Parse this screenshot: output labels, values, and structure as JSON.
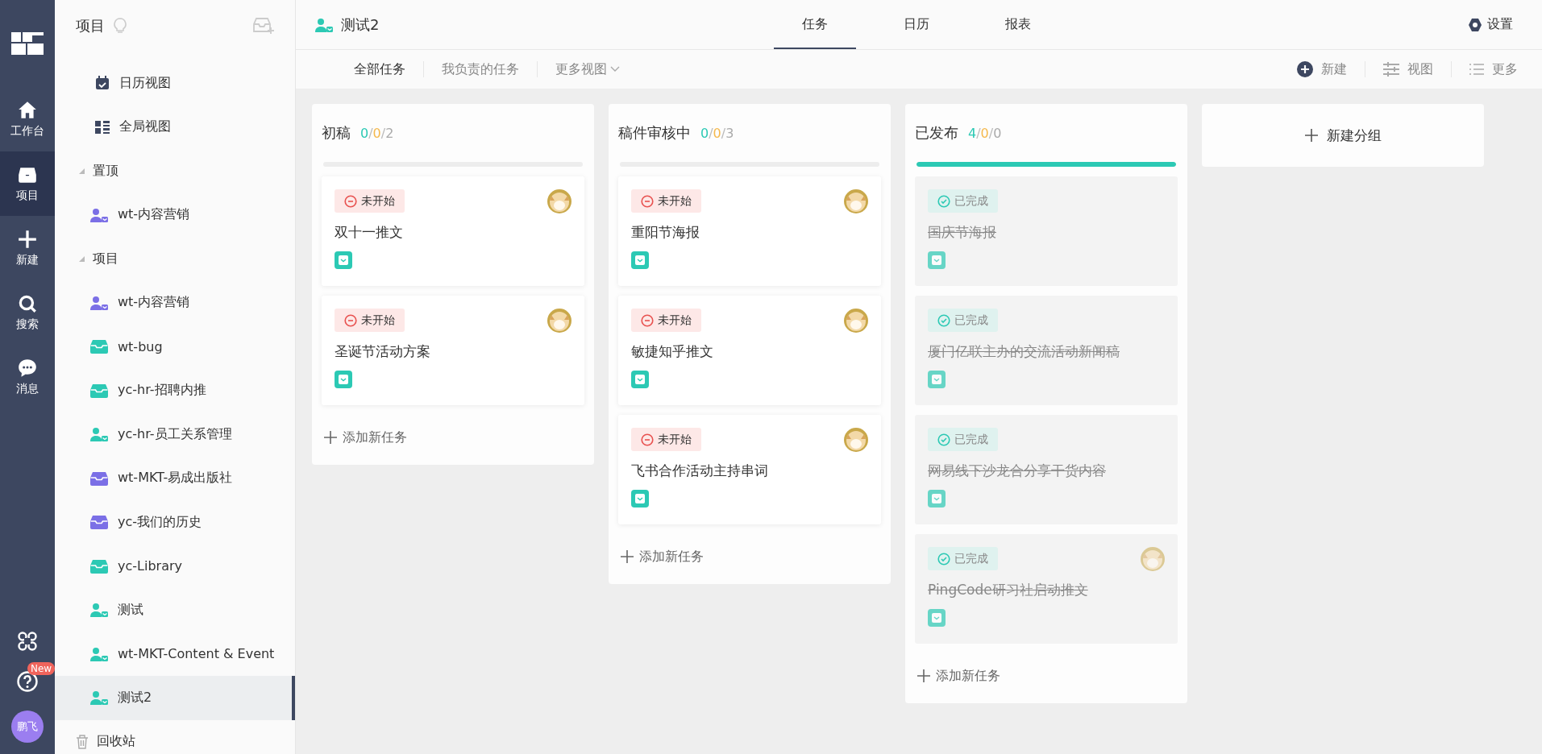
{
  "rail": {
    "items": [
      {
        "label": "工作台",
        "kind": "home",
        "selected": false
      },
      {
        "label": "项目",
        "kind": "box",
        "selected": true
      },
      {
        "label": "新建",
        "kind": "plus",
        "selected": false
      },
      {
        "label": "搜索",
        "kind": "search",
        "selected": false
      },
      {
        "label": "消息",
        "kind": "chat",
        "selected": false
      }
    ],
    "badge": "New",
    "user": "鹏飞"
  },
  "sidebar": {
    "title": "项目",
    "views": [
      {
        "label": "日历视图",
        "kind": "calendar"
      },
      {
        "label": "全局视图",
        "kind": "grid"
      }
    ],
    "sections": [
      {
        "label": "置顶",
        "expanded": true,
        "items": [
          {
            "label": "wt-内容营销",
            "kind": "person",
            "color": "#7b6fe6",
            "selected": false
          }
        ]
      },
      {
        "label": "项目",
        "expanded": true,
        "items": [
          {
            "label": "wt-内容营销",
            "kind": "person",
            "color": "#7b6fe6",
            "selected": false
          },
          {
            "label": "wt-bug",
            "kind": "box",
            "color": "#2cc9b4",
            "selected": false
          },
          {
            "label": "yc-hr-招聘内推",
            "kind": "box",
            "color": "#2cc9b4",
            "selected": false
          },
          {
            "label": "yc-hr-员工关系管理",
            "kind": "person",
            "color": "#2cc9b4",
            "selected": false
          },
          {
            "label": "wt-MKT-易成出版社",
            "kind": "box",
            "color": "#7b6fe6",
            "selected": false
          },
          {
            "label": "yc-我们的历史",
            "kind": "box",
            "color": "#7b6fe6",
            "selected": false
          },
          {
            "label": "yc-Library",
            "kind": "box",
            "color": "#2cc9b4",
            "selected": false
          },
          {
            "label": "测试",
            "kind": "person",
            "color": "#2cc9b4",
            "selected": false
          },
          {
            "label": "wt-MKT-Content & Event",
            "kind": "person",
            "color": "#2cc9b4",
            "selected": false
          },
          {
            "label": "测试2",
            "kind": "person",
            "color": "#2cc9b4",
            "selected": true
          }
        ]
      }
    ],
    "trash": "回收站"
  },
  "header": {
    "project": "测试2",
    "tabs": [
      {
        "label": "任务",
        "selected": true
      },
      {
        "label": "日历",
        "selected": false
      },
      {
        "label": "报表",
        "selected": false
      }
    ],
    "settings": "设置"
  },
  "subnav": {
    "filters": [
      {
        "label": "全部任务",
        "selected": true
      },
      {
        "label": "我负责的任务",
        "selected": false
      },
      {
        "label": "更多视图",
        "selected": false,
        "dropdown": true
      }
    ],
    "actions": [
      {
        "label": "新建",
        "kind": "plus"
      },
      {
        "label": "视图",
        "kind": "sliders"
      },
      {
        "label": "更多",
        "kind": "list"
      }
    ]
  },
  "board": {
    "columns": [
      {
        "title": "初稿",
        "count": [
          "0",
          "/",
          "0",
          "/",
          "2"
        ],
        "level": 0,
        "add": "添加新任务",
        "cards": [
          {
            "kind": "not_started",
            "status_label": "未开始",
            "title": "双十一推文",
            "avatar": true
          },
          {
            "kind": "not_started",
            "status_label": "未开始",
            "title": "圣诞节活动方案",
            "avatar": true
          }
        ]
      },
      {
        "title": "稿件审核中",
        "count": [
          "0",
          "/",
          "0",
          "/",
          "3"
        ],
        "level": 0,
        "add": "添加新任务",
        "cards": [
          {
            "kind": "not_started",
            "status_label": "未开始",
            "title": "重阳节海报",
            "avatar": true
          },
          {
            "kind": "not_started",
            "status_label": "未开始",
            "title": "敏捷知乎推文",
            "avatar": true
          },
          {
            "kind": "not_started",
            "status_label": "未开始",
            "title": "飞书合作活动主持串词",
            "avatar": true
          }
        ]
      },
      {
        "title": "已发布",
        "count": [
          "4",
          "/",
          "0",
          "/",
          "0"
        ],
        "level": 1,
        "add": "添加新任务",
        "cards": [
          {
            "kind": "done",
            "status_label": "已完成",
            "title": "国庆节海报",
            "avatar": false
          },
          {
            "kind": "done",
            "status_label": "已完成",
            "title": "厦门亿联主办的交流活动新闻稿",
            "avatar": false
          },
          {
            "kind": "done",
            "status_label": "已完成",
            "title": "网易线下沙龙合分享干货内容",
            "avatar": false
          },
          {
            "kind": "done",
            "status_label": "已完成",
            "title": "PingCode研习社启动推文",
            "avatar": true
          }
        ]
      }
    ],
    "new_group": "新建分组"
  }
}
